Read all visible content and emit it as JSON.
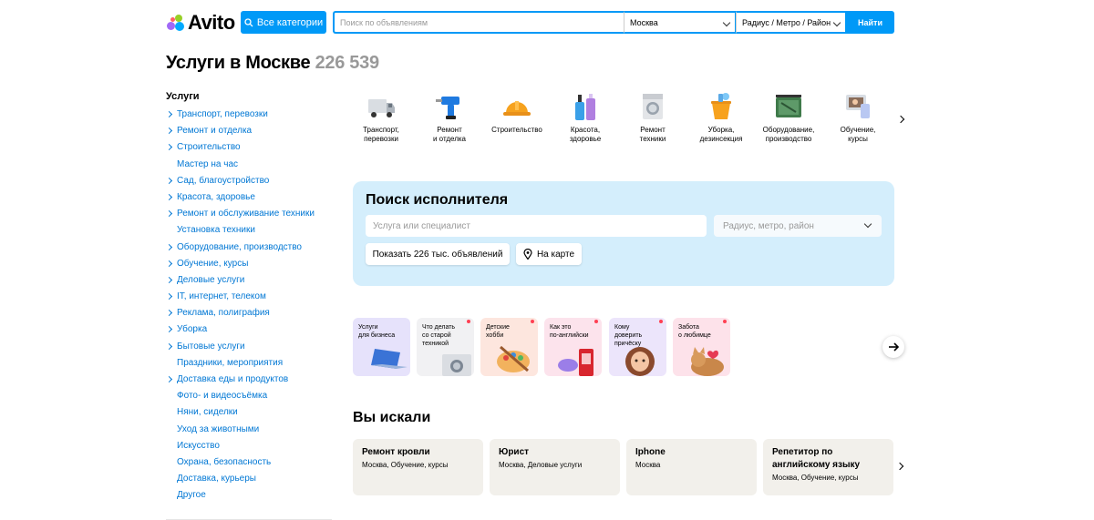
{
  "header": {
    "logo_text": "Avito",
    "categories_button": "Все категории",
    "search_placeholder": "Поиск по объявлениям",
    "city": "Москва",
    "radius": "Радиус / Метро / Район",
    "find_button": "Найти",
    "accent_color": "#0099f7"
  },
  "page": {
    "title": "Услуги в Москве",
    "count": "226 539"
  },
  "sidebar": {
    "heading": "Услуги",
    "items": [
      {
        "label": "Транспорт, перевозки",
        "expandable": true
      },
      {
        "label": "Ремонт и отделка",
        "expandable": true
      },
      {
        "label": "Строительство",
        "expandable": true
      },
      {
        "label": "Мастер на час",
        "expandable": false
      },
      {
        "label": "Сад, благоустройство",
        "expandable": true
      },
      {
        "label": "Красота, здоровье",
        "expandable": true
      },
      {
        "label": "Ремонт и обслуживание техники",
        "expandable": true
      },
      {
        "label": "Установка техники",
        "expandable": false
      },
      {
        "label": "Оборудование, производство",
        "expandable": true
      },
      {
        "label": "Обучение, курсы",
        "expandable": true
      },
      {
        "label": "Деловые услуги",
        "expandable": true
      },
      {
        "label": "IT, интернет, телеком",
        "expandable": true
      },
      {
        "label": "Реклама, полиграфия",
        "expandable": true
      },
      {
        "label": "Уборка",
        "expandable": true
      },
      {
        "label": "Бытовые услуги",
        "expandable": true
      },
      {
        "label": "Праздники, мероприятия",
        "expandable": false
      },
      {
        "label": "Доставка еды и продуктов",
        "expandable": true
      },
      {
        "label": "Фото- и видеосъёмка",
        "expandable": false
      },
      {
        "label": "Няни, сиделки",
        "expandable": false
      },
      {
        "label": "Уход за животными",
        "expandable": false
      },
      {
        "label": "Искусство",
        "expandable": false
      },
      {
        "label": "Охрана, безопасность",
        "expandable": false
      },
      {
        "label": "Доставка, курьеры",
        "expandable": false
      },
      {
        "label": "Другое",
        "expandable": false
      }
    ]
  },
  "categories": [
    {
      "label": "Транспорт,\nперевозки",
      "icon": "truck-icon"
    },
    {
      "label": "Ремонт\nи отделка",
      "icon": "drill-icon"
    },
    {
      "label": "Строительство",
      "icon": "hardhat-icon"
    },
    {
      "label": "Красота,\nздоровье",
      "icon": "cosmetics-icon"
    },
    {
      "label": "Ремонт\nтехники",
      "icon": "washing-machine-icon"
    },
    {
      "label": "Уборка,\nдезинсекция",
      "icon": "cleaning-bucket-icon"
    },
    {
      "label": "Оборудование,\nпроизводство",
      "icon": "generator-icon"
    },
    {
      "label": "Обучение,\nкурсы",
      "icon": "video-lesson-icon"
    }
  ],
  "executor_search": {
    "title": "Поиск исполнителя",
    "input_placeholder": "Услуга или специалист",
    "radius_placeholder": "Радиус, метро, район",
    "show_button": "Показать 226 тыс. объявлений",
    "map_button": "На карте",
    "background": "#d4eefc"
  },
  "stories": [
    {
      "text": "Услуги\nдля бизнеса",
      "icon": "laptop-icon",
      "bg": "#e6e2fb"
    },
    {
      "text": "Что делать\nсо старой\nтехникой",
      "icon": "washer-icon",
      "bg": "#f1f1f3"
    },
    {
      "text": "Детские\nхобби",
      "icon": "palette-icon",
      "bg": "#fde6de"
    },
    {
      "text": "Как это\nпо-английски",
      "icon": "phone-booth-icon",
      "bg": "#fce3ec"
    },
    {
      "text": "Кому\nдоверить\nпричёску",
      "icon": "woman-icon",
      "bg": "#ece5fb"
    },
    {
      "text": "Забота\nо любимце",
      "icon": "cat-icon",
      "bg": "#fde2ea"
    }
  ],
  "searched": {
    "title": "Вы искали",
    "items": [
      {
        "query": "Ремонт кровли",
        "meta": "Москва, Обучение, курсы"
      },
      {
        "query": "Юрист",
        "meta": "Москва, Деловые услуги"
      },
      {
        "query": "Iphone",
        "meta": "Москва"
      },
      {
        "query": "Репетитор по английскому языку",
        "meta": "Москва, Обучение, курсы"
      }
    ]
  }
}
